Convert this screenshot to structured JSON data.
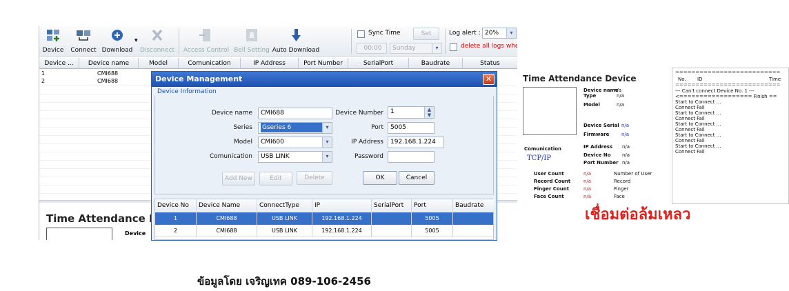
{
  "toolbar": {
    "device": "Device",
    "connect": "Connect",
    "download": "Download",
    "disconnect": "Disconnect",
    "access_control": "Access Control",
    "bell_setting": "Bell Setting",
    "auto_download": "Auto Download",
    "sync_time": "Sync Time",
    "set": "Set",
    "time_value": "00:00",
    "day_value": "Sunday",
    "log_alert_label": "Log alert :",
    "log_alert_value": "20%",
    "delete_logs": "delete all logs when"
  },
  "grid": {
    "columns": [
      "Device ...",
      "Device name",
      "Model",
      "Comunication",
      "IP Address",
      "Port Number",
      "SerialPort",
      "Baudrate",
      "Status"
    ],
    "rows": [
      {
        "no": "1",
        "name": "CMI688"
      },
      {
        "no": "2",
        "name": "CMI688"
      }
    ]
  },
  "bottom_panel": {
    "title": "Time Attendance D",
    "device_label": "Device"
  },
  "dialog": {
    "title": "Device Management",
    "section": "Device Information",
    "labels": {
      "device_name": "Device name",
      "series": "Series",
      "model": "Model",
      "comunication": "Comunication",
      "device_number": "Device Number",
      "port": "Port",
      "ip_address": "IP Address",
      "password": "Password"
    },
    "values": {
      "device_name": "CMI688",
      "series": "Gseries 6",
      "model": "CMI600",
      "comunication": "USB LINK",
      "device_number": "1",
      "port": "5005",
      "ip_address": "192.168.1.224",
      "password": ""
    },
    "buttons": {
      "add_new": "Add New",
      "edit": "Edit",
      "delete": "Delete",
      "ok": "OK",
      "cancel": "Cancel"
    },
    "table": {
      "columns": [
        "Device No",
        "Device Name",
        "ConnectType",
        "IP",
        "SerialPort",
        "Port",
        "Baudrate"
      ],
      "rows": [
        {
          "no": "1",
          "name": "CMI688",
          "type": "USB LINK",
          "ip": "192.168.1.224",
          "serial": "",
          "port": "5005",
          "baud": ""
        },
        {
          "no": "2",
          "name": "CMI688",
          "type": "USB LINK",
          "ip": "192.168.1.224",
          "serial": "",
          "port": "5005",
          "baud": ""
        }
      ]
    }
  },
  "right_panel": {
    "title": "Time Attendance Device",
    "device_name_label": "Device name",
    "type_label": "Type",
    "model_label": "Model",
    "device_serial_label": "Device Serial",
    "firmware_label": "Firmware",
    "ip_address_label": "IP Address",
    "device_no_label": "Device No",
    "port_number_label": "Port Number",
    "comunication_label": "Comunication",
    "tcpip": "TCP/IP",
    "na": "n/a",
    "counts": [
      {
        "label": "User Count",
        "value": "n/a",
        "desc": "Number of User"
      },
      {
        "label": "Record Count",
        "value": "n/a",
        "desc": "Record"
      },
      {
        "label": "Finger Count",
        "value": "n/a",
        "desc": "Finger"
      },
      {
        "label": "Face Count",
        "value": "n/a",
        "desc": "Face"
      }
    ],
    "log_header_no": "No.",
    "log_header_id": "ID",
    "log_header_time": "Time",
    "log_rule": "==========================",
    "log_lines": [
      "--- Can't connect Device No. 1 ---",
      "<================== Finish ==",
      "Start to Connect ...",
      "Connect Fail",
      "Start to Connect ...",
      "Connect Fail",
      "Start to Connect ...",
      "Connect Fail",
      "Start to Connect ...",
      "Connect Fail",
      "Start to Connect ...",
      "Connect Fail"
    ],
    "fail_caption": "เชื่อมต่อล้มเหลว"
  },
  "footer": "ข้อมูลโดย เจริญเทค 089-106-2456",
  "colors": {
    "dialog_title": "#1d4fae",
    "selected_row": "#3670c8",
    "fail_text": "#e0201c"
  }
}
